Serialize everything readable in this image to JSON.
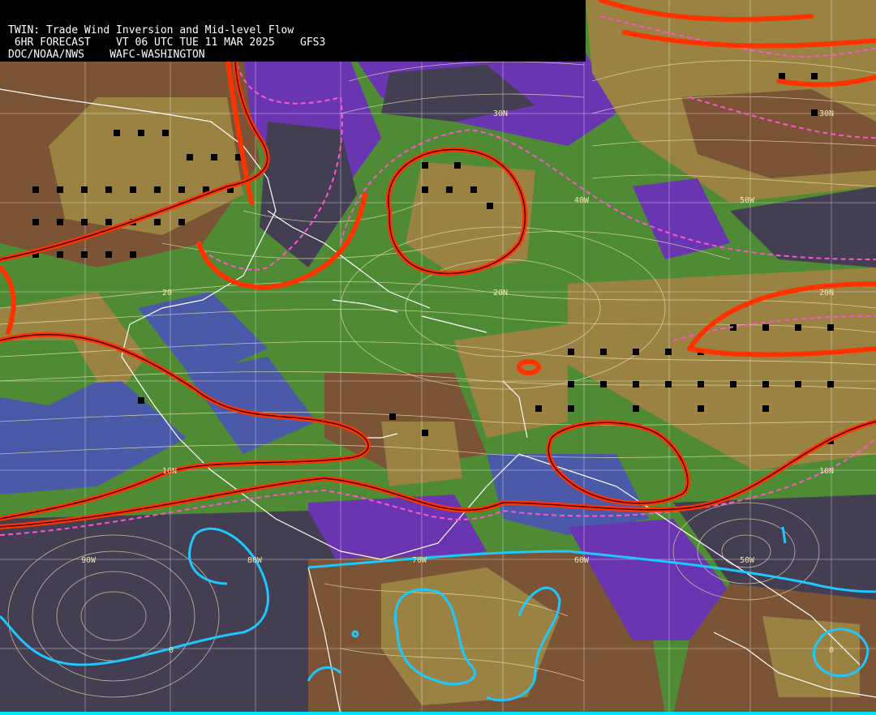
{
  "header": {
    "line1": "TWIN: Trade Wind Inversion and Mid-level Flow",
    "line2": " 6HR FORECAST    VT 06 UTC TUE 11 MAR 2025    GFS3",
    "line3": "DOC/NOAA/NWS    WAFC-WASHINGTON"
  },
  "grid_labels": {
    "lat_30n_a": "30N",
    "lat_30n_b": "30N",
    "lat_20n_a": "20",
    "lat_20n_b": "20N",
    "lat_20n_c": "20N",
    "lat_10n_a": "10N",
    "lat_10n_b": "10N",
    "lon_90w": "90W",
    "lon_80w": "80W",
    "lon_70w": "70W",
    "lon_60w": "60W",
    "lon_50w_a": "50W",
    "lon_50w_b": "50W",
    "lon_40w": "40W",
    "zero_a": "0",
    "zero_b": "0"
  },
  "colors": {
    "ocean_green": "#4f8a35",
    "tan": "#9a8243",
    "brown": "#7a5435",
    "purple": "#6a35b0",
    "dark_slate": "#433e52",
    "blue": "#4a5aa8",
    "red_contour": "#ff1a1a",
    "magenta_dash": "#ff55cc",
    "cyan_contour": "#1ec8ff",
    "coast": "#ffffff",
    "streamline": "#efe4b0"
  }
}
